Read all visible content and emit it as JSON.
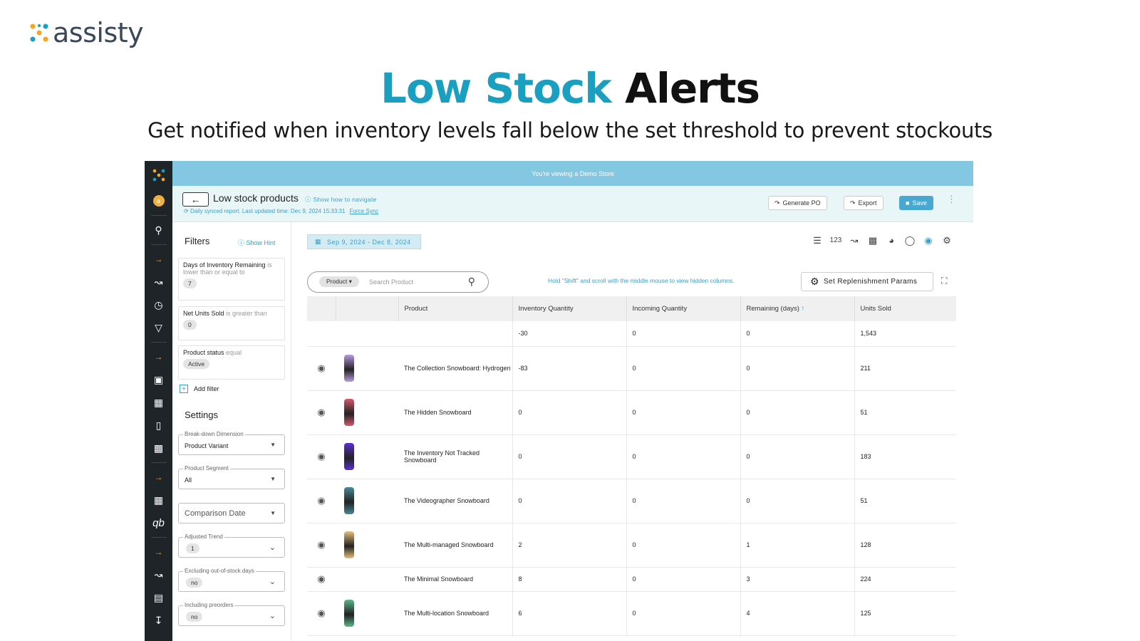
{
  "brand": {
    "name": "assisty"
  },
  "hero": {
    "title_accent": "Low Stock",
    "title_rest": "Alerts",
    "subtitle": "Get notified when inventory levels fall below the set threshold to prevent stockouts"
  },
  "app": {
    "banner": "You're viewing a Demo Store",
    "avatar_letter": "a",
    "header": {
      "title": "Low stock products",
      "hint_link": "Show how to navigate",
      "sync_text": "Daily synced report. Last updated time: Dec 9, 2024 15:33:31",
      "force_sync": "Force Sync",
      "generate_po": "Generate PO",
      "export": "Export",
      "save": "Save"
    },
    "filters": {
      "title": "Filters",
      "show_hint": "Show Hint",
      "items": [
        {
          "field": "Days of Inventory Remaining",
          "op": "is lower than or equal to",
          "value": "7"
        },
        {
          "field": "Net Units Sold",
          "op": "is greater than",
          "value": "0"
        },
        {
          "field": "Product status",
          "op": "equal",
          "value": "Active"
        }
      ],
      "add_filter": "Add filter"
    },
    "settings": {
      "title": "Settings",
      "breakdown": {
        "label": "Break-down Dimension",
        "value": "Product Variant"
      },
      "segment": {
        "label": "Product Segment",
        "value": "All"
      },
      "comparison": {
        "value": "Comparison Date"
      },
      "trend": {
        "label": "Adjusted Trend",
        "value": "1"
      },
      "excluding": {
        "label": "Excluding out-of-stock days",
        "value": "no"
      },
      "preorders": {
        "label": "Including preorders",
        "value": "no"
      }
    },
    "toolbar": {
      "date_range": "Sep 9, 2024 - Dec 8, 2024",
      "view_123": "123",
      "search_chip": "Product",
      "search_placeholder": "Search Product",
      "scroll_hint": "Hold \"Shift\" and scroll with the middle mouse to view hidden columns.",
      "replenish": "Set Replenishment Params"
    },
    "table": {
      "columns": [
        "Product",
        "Inventory Quantity",
        "Incoming Quantity",
        "Remaining (days)",
        "Units Sold"
      ],
      "totals": [
        "-30",
        "0",
        "0",
        "1,543"
      ],
      "rows": [
        {
          "product": "The Collection Snowboard: Hydrogen",
          "inventory": "-83",
          "incoming": "0",
          "remaining": "0",
          "sold": "211",
          "thumb": "#b79be0"
        },
        {
          "product": "The Hidden Snowboard",
          "inventory": "0",
          "incoming": "0",
          "remaining": "0",
          "sold": "51",
          "thumb": "#d45a6a"
        },
        {
          "product": "The Inventory Not Tracked Snowboard",
          "inventory": "0",
          "incoming": "0",
          "remaining": "0",
          "sold": "183",
          "thumb": "#5a2fd0"
        },
        {
          "product": "The Videographer Snowboard",
          "inventory": "0",
          "incoming": "0",
          "remaining": "0",
          "sold": "51",
          "thumb": "#4a8a9a"
        },
        {
          "product": "The Multi-managed Snowboard",
          "inventory": "2",
          "incoming": "0",
          "remaining": "1",
          "sold": "128",
          "thumb": "#e4c07a"
        },
        {
          "product": "The Minimal Snowboard",
          "inventory": "8",
          "incoming": "0",
          "remaining": "3",
          "sold": "224",
          "thumb": ""
        },
        {
          "product": "The Multi-location Snowboard",
          "inventory": "6",
          "incoming": "0",
          "remaining": "4",
          "sold": "125",
          "thumb": "#5ab88a"
        }
      ]
    }
  }
}
